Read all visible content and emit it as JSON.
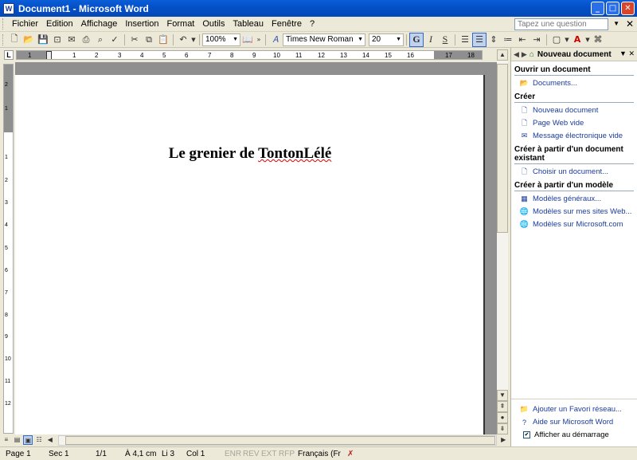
{
  "window": {
    "title": "Document1 - Microsoft Word",
    "app_icon": "W",
    "minimize": "_",
    "maximize": "□",
    "close": "✕"
  },
  "menu": {
    "items": [
      "Fichier",
      "Edition",
      "Affichage",
      "Insertion",
      "Format",
      "Outils",
      "Tableau",
      "Fenêtre",
      "?"
    ],
    "ask_placeholder": "Tapez une question",
    "doc_close": "✕"
  },
  "toolbar": {
    "zoom": "100%",
    "font": "Times New Roman",
    "size": "20",
    "bold": "G",
    "italic": "I",
    "shadow": "S"
  },
  "ruler": {
    "tab": "L",
    "numbers": [
      "1",
      "1",
      "2",
      "3",
      "4",
      "5",
      "6",
      "7",
      "8",
      "9",
      "10",
      "11",
      "12",
      "13",
      "14",
      "15",
      "16",
      "17",
      "18"
    ],
    "vnumbers": [
      "2",
      "1",
      "1",
      "2",
      "3",
      "4",
      "5",
      "6",
      "7",
      "8",
      "9",
      "10",
      "11",
      "12"
    ]
  },
  "document": {
    "title_part1": "Le grenier de ",
    "title_part2": "TontonLélé"
  },
  "status": {
    "page": "Page  1",
    "sec": "Sec  1",
    "pages": "1/1",
    "at": "À  4,1 cm",
    "line": "Li  3",
    "col": "Col  1",
    "enr": "ENR",
    "rev": "REV",
    "ext": "EXT",
    "rfp": "RFP",
    "lang": "Français (Fr"
  },
  "taskpane": {
    "title": "Nouveau document",
    "section_open": "Ouvrir un document",
    "documents": "Documents...",
    "section_create": "Créer",
    "new_document": "Nouveau document",
    "web_page": "Page Web vide",
    "email": "Message électronique vide",
    "section_existing": "Créer à partir d'un document existant",
    "choose_doc": "Choisir un document...",
    "section_template": "Créer à partir d'un modèle",
    "general_templates": "Modèles généraux...",
    "web_templates": "Modèles sur mes sites Web...",
    "ms_templates": "Modèles sur Microsoft.com",
    "add_favorite": "Ajouter un Favori réseau...",
    "help": "Aide sur Microsoft Word",
    "show_at_startup": "Afficher au démarrage"
  }
}
